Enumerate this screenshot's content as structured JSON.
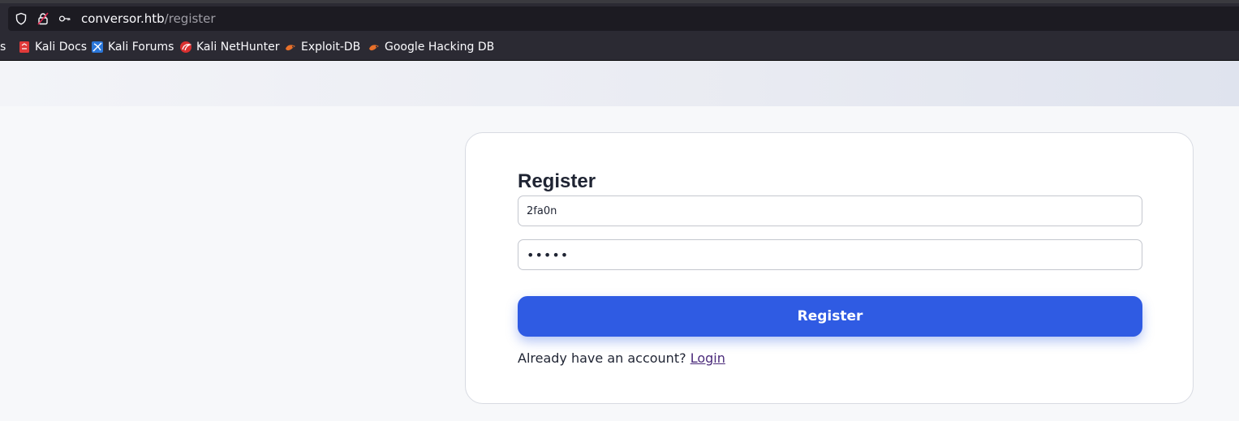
{
  "browser": {
    "url_host": "conversor.htb",
    "url_path": "/register",
    "icons": [
      "shield-icon",
      "lock-insecure-icon",
      "key-icon"
    ]
  },
  "bookmarks": [
    {
      "label": "s",
      "icon": "none"
    },
    {
      "label": "Kali Docs",
      "icon": "kali-docs-icon"
    },
    {
      "label": "Kali Forums",
      "icon": "kali-forums-icon"
    },
    {
      "label": "Kali NetHunter",
      "icon": "kali-nethunter-icon"
    },
    {
      "label": "Exploit-DB",
      "icon": "exploit-db-icon"
    },
    {
      "label": "Google Hacking DB",
      "icon": "ghdb-icon"
    }
  ],
  "form": {
    "title": "Register",
    "username_value": "2fa0n",
    "password_value": "•••••",
    "submit_label": "Register",
    "footer_text": "Already have an account?",
    "login_link": "Login"
  },
  "colors": {
    "accent": "#2f5be3",
    "browser_chrome": "#2b2a33",
    "urlbar": "#1c1b22",
    "link": "#4a2a7a"
  }
}
